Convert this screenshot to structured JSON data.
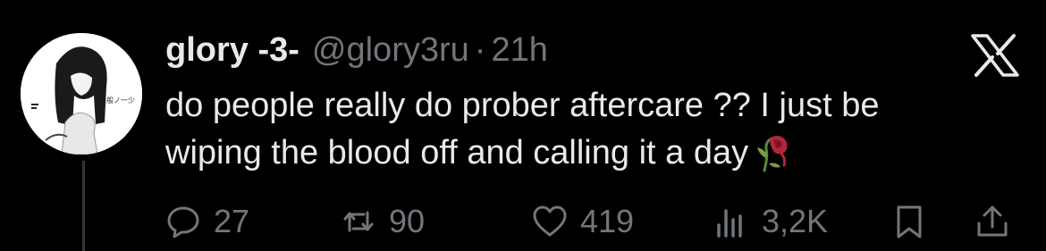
{
  "tweet": {
    "display_name": "glory -3-",
    "handle": "@glory3ru",
    "separator": "·",
    "time": "21h",
    "text_line_1": "do people really do prober aftercare ?? I just be",
    "text_line_2": "wiping the blood off and calling it a day",
    "emoji": "wilted-rose-emoji"
  },
  "avatar": {
    "watermark_text": "般ノ一少"
  },
  "actions": {
    "replies": "27",
    "reposts": "90",
    "likes": "419",
    "views": "3,2K"
  },
  "icons": {
    "reply": "reply-icon",
    "repost": "repost-icon",
    "like": "heart-icon",
    "views": "views-icon",
    "bookmark": "bookmark-icon",
    "share": "share-icon",
    "brand": "x-logo-icon"
  },
  "colors": {
    "background": "#000000",
    "primary_text": "#e7e9ea",
    "secondary_text": "#71767b",
    "thread_line": "#333639"
  }
}
